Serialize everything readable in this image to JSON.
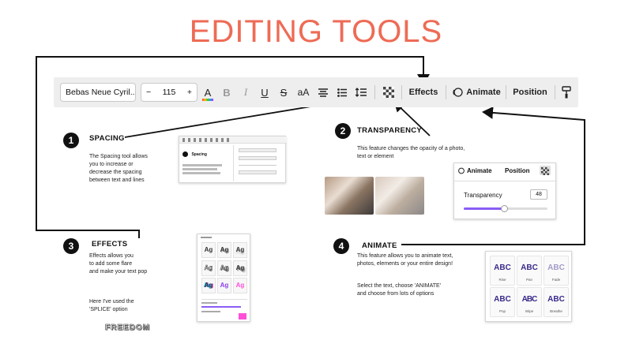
{
  "title": "EDITING TOOLS",
  "toolbar": {
    "font_name": "Bebas Neue Cyril...",
    "minus": "−",
    "font_size": "115",
    "plus": "+",
    "text_color": "A",
    "bold": "B",
    "italic": "I",
    "underline": "U",
    "strike": "S",
    "case": "aA",
    "effects": "Effects",
    "animate": "Animate",
    "position": "Position"
  },
  "sections": {
    "spacing": {
      "number": "1",
      "heading": "SPACING",
      "text_lines": [
        "The Spacing tool allows",
        "you to increase or",
        "decrease the spacing",
        "between text and lines"
      ]
    },
    "transparency": {
      "number": "2",
      "heading": "TRANSPARENCY",
      "text_lines": [
        "This feature changes the opacity of a photo,",
        "text or element"
      ],
      "panel": {
        "animate": "Animate",
        "position": "Position",
        "label": "Transparency",
        "value": "48",
        "level": 0.48
      }
    },
    "effects": {
      "number": "3",
      "heading": "EFFECTS",
      "text_lines": [
        "Effects allows you",
        "to add some flare",
        "and make your text pop"
      ],
      "note_lines": [
        "Here I've used the",
        "'SPLICE' option"
      ],
      "sample": "FREEDOM",
      "thumb": "Ag"
    },
    "animate": {
      "number": "4",
      "heading": "ANIMATE",
      "text_lines": [
        "This feature allows you to animate text,",
        "photos, elements or your entire design!"
      ],
      "note_lines": [
        "Select the text, choose 'ANIMATE'",
        "and choose from lots of options"
      ],
      "tiles": [
        "ABC",
        "ABC",
        "ABC",
        "ABC",
        "ABC",
        "ABC"
      ],
      "tile_labels": [
        "Rise",
        "Pan",
        "Fade",
        "Pop",
        "Wipe",
        "Breathe"
      ]
    }
  },
  "mini_spacing": {
    "heading": "Spacing"
  },
  "colors": {
    "title": "#ee6b55",
    "toolbar_bg": "#eeeeee",
    "slider": "#8a5cf6",
    "animate_text": "#3b2a8a",
    "swatch_pink": "#ff4fd8"
  }
}
